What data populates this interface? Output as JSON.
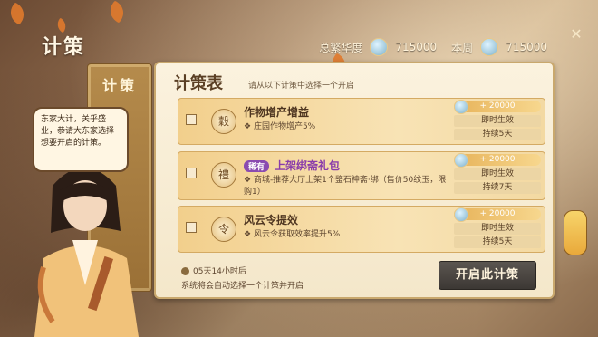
{
  "header": {
    "title": "计策",
    "total_label": "总繁华度",
    "total_value": "715000",
    "week_label": "本周",
    "week_value": "715000"
  },
  "side_tab": {
    "label": "计策"
  },
  "npc": {
    "speech": "东家大计，关乎盛业，恭请大东家选择想要开启的计策。"
  },
  "panel": {
    "title": "计策表",
    "subtitle": "请从以下计策中选择一个开启",
    "strategies": [
      {
        "name": "作物增产增益",
        "rare_badge": "",
        "desc": "庄园作物增产5%",
        "cost": "+ 20000",
        "effect": "即时生效",
        "duration": "持续5天"
      },
      {
        "name": "上架绑斋礼包",
        "rare_badge": "稀有",
        "desc": "商城-推荐大厅上架1个鉴石神斋·绑（售价50纹玉，限购1）",
        "cost": "+ 20000",
        "effect": "即时生效",
        "duration": "持续7天"
      },
      {
        "name": "风云令提效",
        "rare_badge": "",
        "desc": "风云令获取效率提升5%",
        "cost": "+ 20000",
        "effect": "即时生效",
        "duration": "持续5天"
      }
    ],
    "timer": "05天14小时后",
    "hint": "系统将会自动选择一个计策并开启",
    "start_button": "开启此计策"
  }
}
